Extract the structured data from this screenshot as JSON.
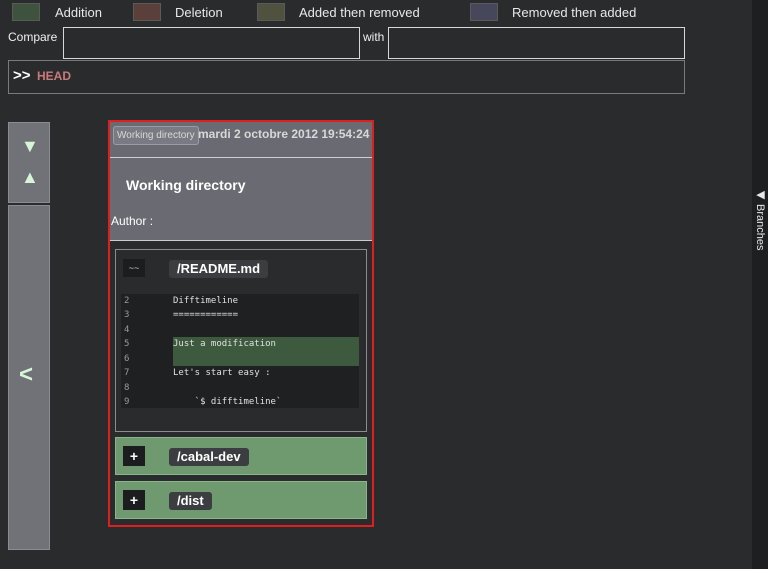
{
  "legend": [
    {
      "label": "Addition",
      "color": "#3d533d"
    },
    {
      "label": "Deletion",
      "color": "#5a3f3a"
    },
    {
      "label": "Added then removed",
      "color": "#4f523f"
    },
    {
      "label": "Removed then added",
      "color": "#46475a"
    }
  ],
  "compare": {
    "label": "Compare",
    "with_label": "with",
    "from_value": "",
    "to_value": ""
  },
  "head": {
    "arrows": ">>",
    "label": "HEAD"
  },
  "nav": {
    "down": "▼",
    "up": "▲",
    "back": "<"
  },
  "commit": {
    "badge": "Working directory",
    "date": "mardi 2 octobre 2012 19:54:24",
    "title": "Working directory",
    "author_label": "Author :"
  },
  "file": {
    "icon": "~~",
    "name": "/README.md",
    "lines": [
      {
        "num": "2",
        "code": "Difftimeline"
      },
      {
        "num": "3",
        "code": "============"
      },
      {
        "num": "4",
        "code": ""
      },
      {
        "num": "5",
        "code": "Just a modification"
      },
      {
        "num": "6",
        "code": ""
      },
      {
        "num": "7",
        "code": "Let's start easy :"
      },
      {
        "num": "8",
        "code": ""
      },
      {
        "num": "9",
        "code": "    `$ difftimeline`"
      }
    ]
  },
  "dirs": [
    {
      "expand": "+",
      "name": "/cabal-dev"
    },
    {
      "expand": "+",
      "name": "/dist"
    }
  ],
  "sidebar": {
    "branches_label": "◀ Branches"
  },
  "colors": {
    "accent_red": "#dd1f1f",
    "head_red": "#c97a7a",
    "dir_green": "#6f9a6f"
  }
}
